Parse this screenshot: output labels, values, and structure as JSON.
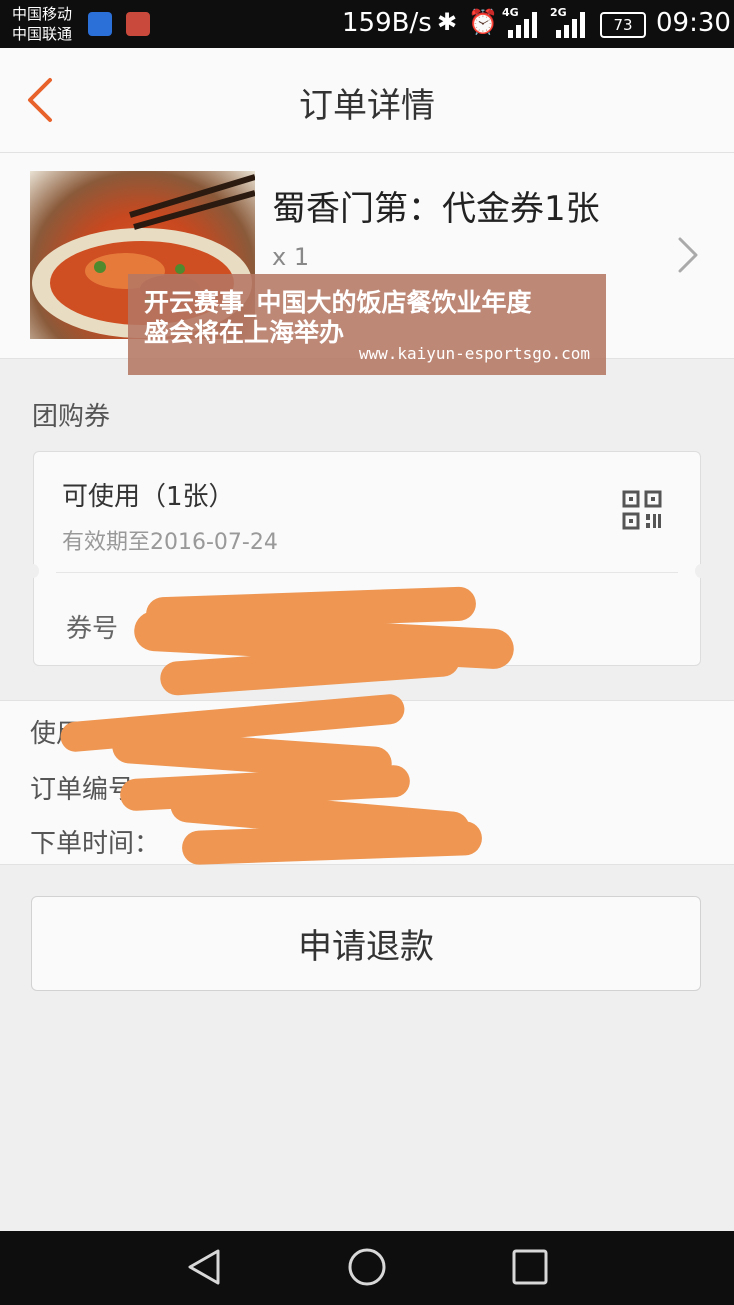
{
  "status_bar": {
    "carrier_1": "中国移动",
    "carrier_2": "中国联通",
    "net_speed": "159B/s",
    "network_1": "4G",
    "network_2": "2G",
    "battery": "73",
    "time": "09:30",
    "icons": [
      "baidu-app-icon",
      "notification-app-icon",
      "bluetooth-icon",
      "alarm-icon",
      "signal-icon",
      "signal-icon",
      "battery-icon"
    ]
  },
  "header": {
    "title": "订单详情",
    "back_icon": "chevron-left-icon",
    "accent_color": "#e8622c"
  },
  "product": {
    "name": "蜀香门第：代金券1张",
    "quantity": "x 1",
    "image": "dish-photo"
  },
  "watermark": {
    "line1": "开云赛事_中国大的饭店餐饮业年度",
    "line2": "盛会将在上海举办",
    "url": "www.kaiyun-esportsgo.com"
  },
  "voucher_section": {
    "title": "团购券",
    "status": "可使用（1张）",
    "validity": "有效期至2016-07-24",
    "code_label": "券号",
    "qr_icon": "qr-code-icon"
  },
  "order_info": {
    "usage_label": "使用",
    "order_number_label": "订单编号：",
    "order_time_label": "下单时间：",
    "redaction_color": "#ee9652"
  },
  "actions": {
    "refund_label": "申请退款"
  },
  "nav_bar": {
    "icons": [
      "back-triangle-icon",
      "home-circle-icon",
      "recent-apps-square-icon"
    ]
  }
}
